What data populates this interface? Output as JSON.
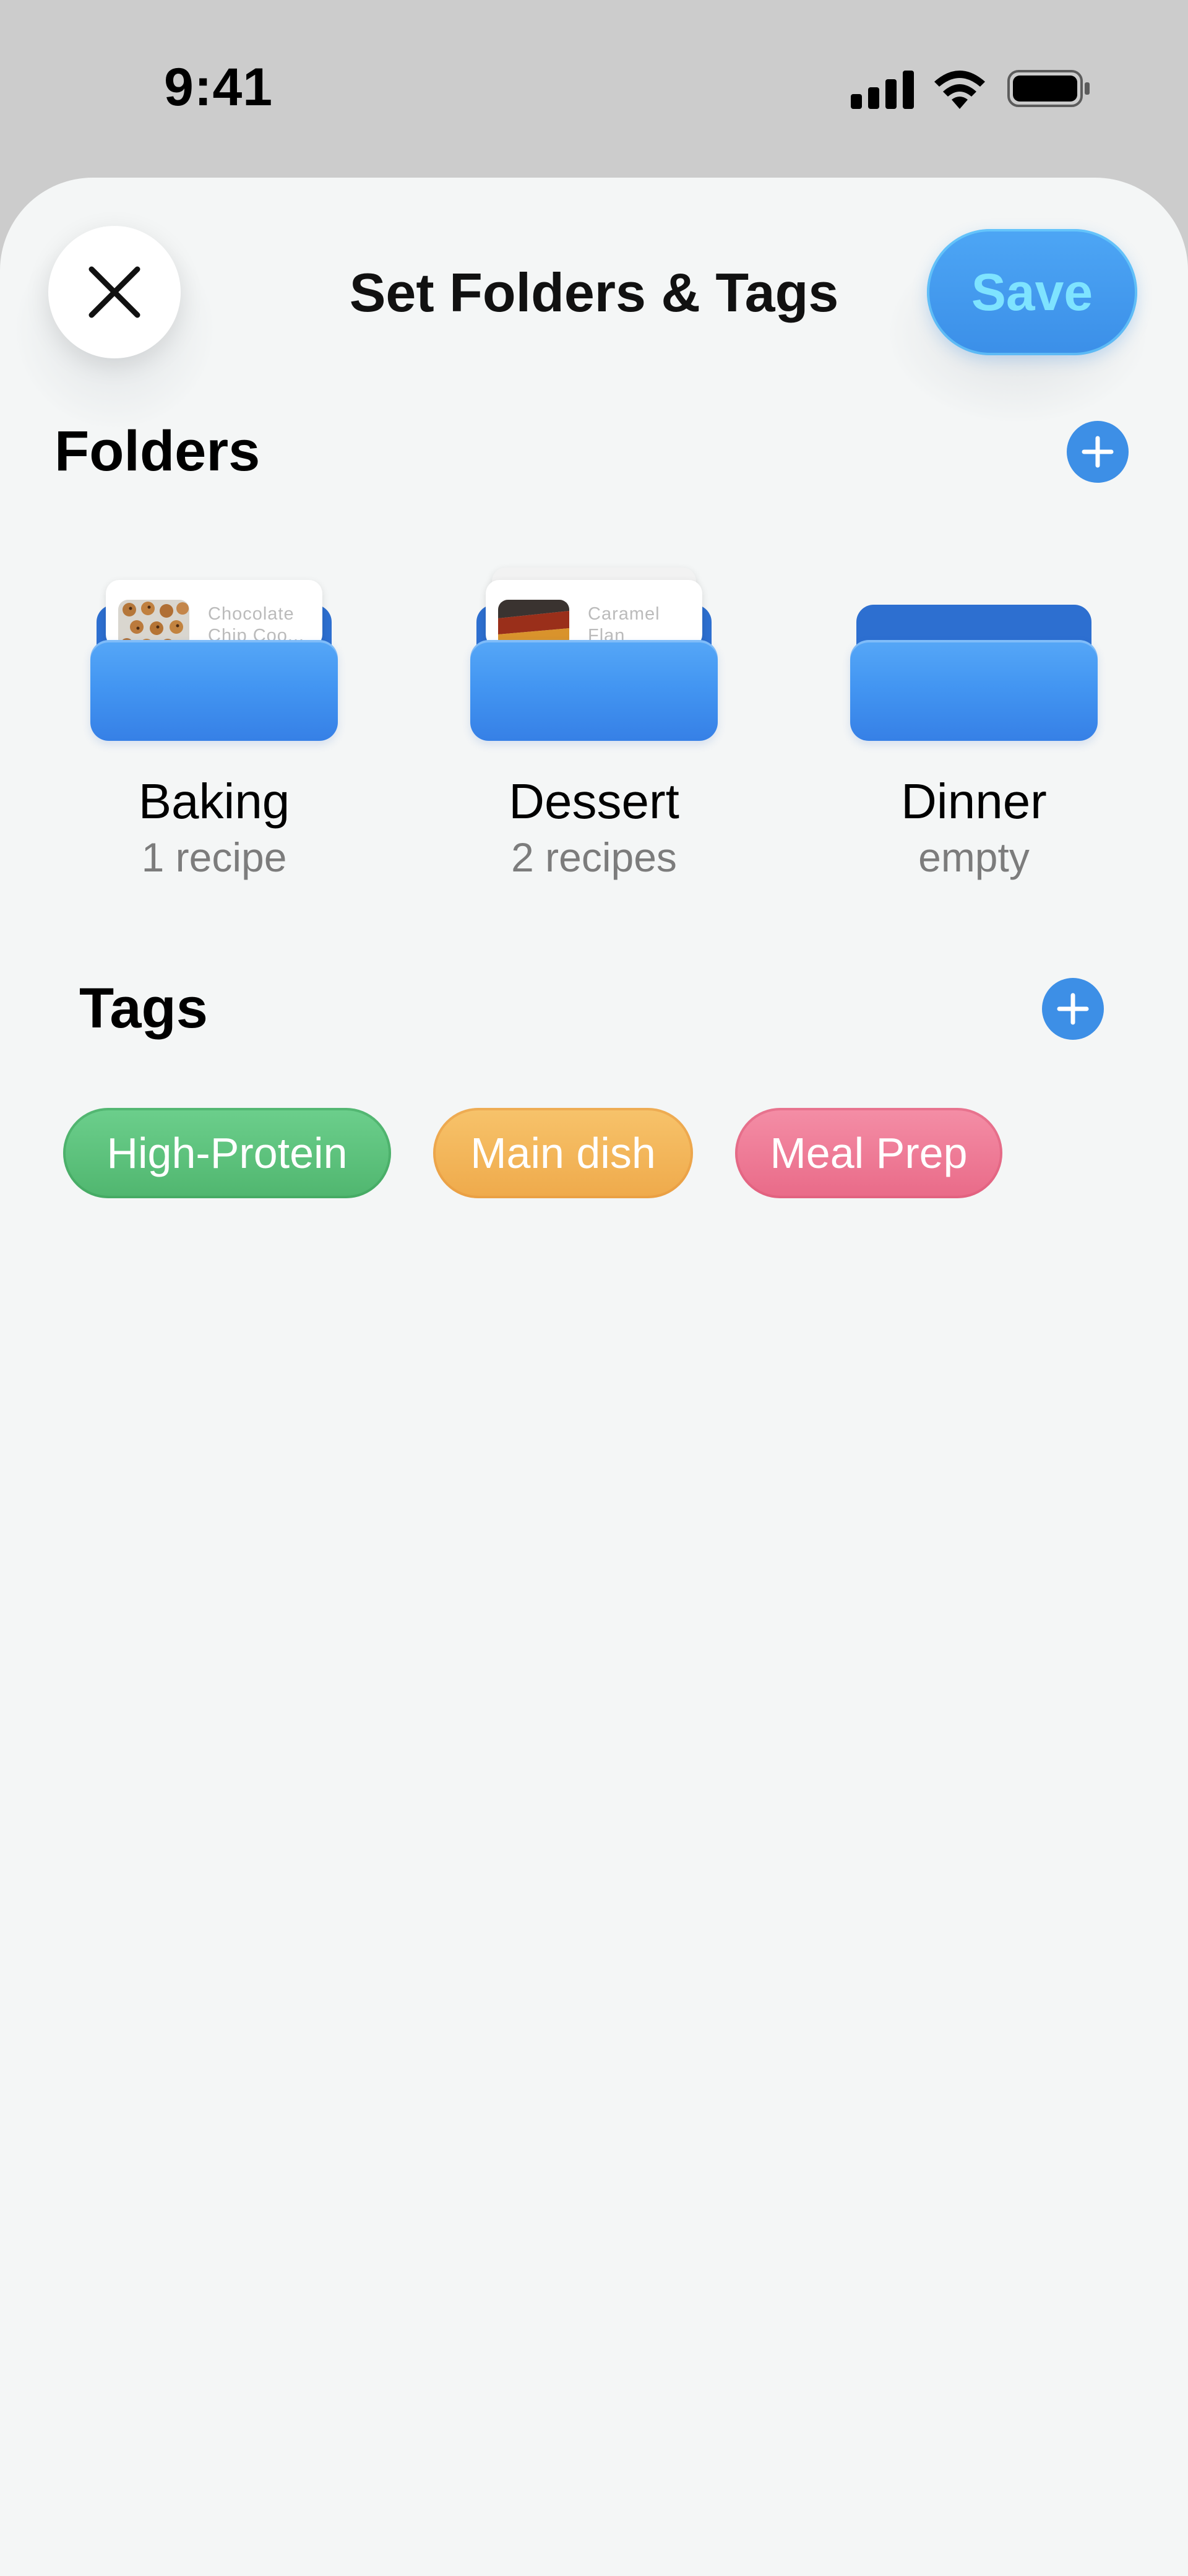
{
  "status_bar": {
    "time": "9:41"
  },
  "header": {
    "title": "Set Folders & Tags",
    "save_label": "Save"
  },
  "folders_section": {
    "title": "Folders",
    "folders": [
      {
        "name": "Baking",
        "count": "1 recipe",
        "recipe_title_line1": "Chocolate",
        "recipe_title_line2": "Chip Coo..."
      },
      {
        "name": "Dessert",
        "count": "2 recipes",
        "recipe_title_line1": "Caramel",
        "recipe_title_line2": "Flan"
      },
      {
        "name": "Dinner",
        "count": "empty"
      }
    ]
  },
  "tags_section": {
    "title": "Tags",
    "tags": [
      {
        "label": "High-Protein",
        "color": "#5bbf7a"
      },
      {
        "label": "Main dish",
        "color": "#f2b55a"
      },
      {
        "label": "Meal Prep",
        "color": "#ee7a95"
      }
    ]
  },
  "colors": {
    "accent": "#3d8fe6",
    "sheet_background": "#f4f6f6",
    "save_text": "#7ee3ff"
  }
}
